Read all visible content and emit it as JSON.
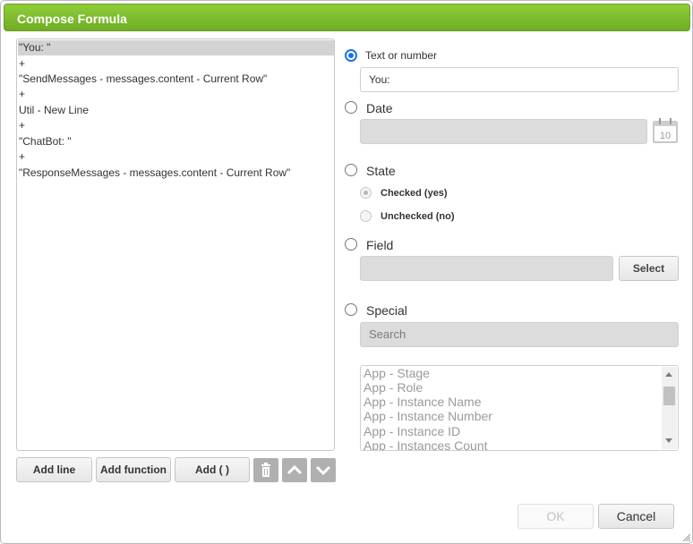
{
  "dialog": {
    "title": "Compose Formula"
  },
  "formula": {
    "lines": [
      "\"You: \"",
      "+",
      "\"SendMessages - messages.content - Current Row\"",
      "+",
      "Util - New Line",
      "+",
      "\"ChatBot: \"",
      "+",
      "\"ResponseMessages - messages.content - Current Row\""
    ],
    "selected_index": 0
  },
  "formula_buttons": {
    "add_line": "Add line",
    "add_function": "Add function",
    "add_parens": "Add ( )"
  },
  "options": {
    "text_or_number": {
      "label": "Text or number",
      "value": "You:",
      "checked": true
    },
    "date": {
      "label": "Date"
    },
    "state": {
      "label": "State",
      "checked_yes": "Checked (yes)",
      "unchecked_no": "Unchecked (no)"
    },
    "field": {
      "label": "Field",
      "select_button": "Select"
    },
    "special": {
      "label": "Special",
      "search_placeholder": "Search",
      "items": [
        "App - Stage",
        "App - Role",
        "App - Instance Name",
        "App - Instance Number",
        "App - Instance ID",
        "App - Instances Count"
      ]
    }
  },
  "footer": {
    "ok": "OK",
    "cancel": "Cancel"
  },
  "colors": {
    "title_bar": "#7dbd2e",
    "radio_accent": "#1a73e8"
  }
}
